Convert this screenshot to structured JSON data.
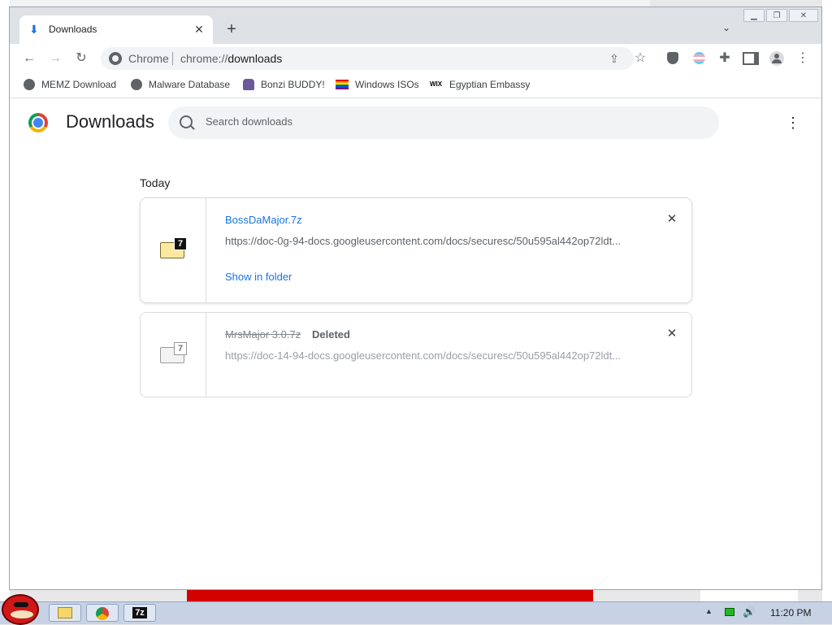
{
  "browser": {
    "tab": {
      "title": "Downloads"
    },
    "omnibox": {
      "chip": "Chrome",
      "url_scheme": "chrome://",
      "url_path": "downloads"
    },
    "bookmarks": [
      {
        "label": "MEMZ Download",
        "icon": "globe-icon"
      },
      {
        "label": "Malware Database",
        "icon": "globe-icon"
      },
      {
        "label": "Bonzi BUDDY!",
        "icon": "bonzi-icon"
      },
      {
        "label": "Windows ISOs",
        "icon": "rainbow-flag-icon"
      },
      {
        "label": "Egyptian Embassy",
        "icon": "wix-icon",
        "icon_text": "WIX"
      }
    ]
  },
  "downloads_page": {
    "title": "Downloads",
    "search_placeholder": "Search downloads",
    "section": "Today",
    "items": [
      {
        "filename": "BossDaMajor.7z",
        "url": "https://doc-0g-94-docs.googleusercontent.com/docs/securesc/50u595al442op72ldt...",
        "action": "Show in folder",
        "status": ""
      },
      {
        "filename": "MrsMajor 3.0.7z",
        "url": "https://doc-14-94-docs.googleusercontent.com/docs/securesc/50u595al442op72ldt...",
        "action": "",
        "status": "Deleted"
      }
    ],
    "badge_glyph": "7"
  },
  "taskbar": {
    "clock": "11:20 PM",
    "apps": [
      "explorer",
      "chrome",
      "7-zip"
    ],
    "sevenzip_label": "7z"
  },
  "colors": {
    "accent": "#1a73e8",
    "title_bar": "#dee1e6",
    "taskbar": "#c7d3e4"
  }
}
